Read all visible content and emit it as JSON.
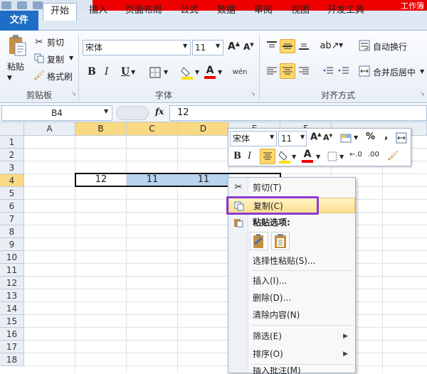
{
  "window": {
    "title_fragment": "工作簿"
  },
  "tabs": {
    "file": "文件",
    "items": [
      "开始",
      "插入",
      "页面布局",
      "公式",
      "数据",
      "审阅",
      "视图",
      "开发工具"
    ],
    "active_index": 0
  },
  "ribbon": {
    "clipboard": {
      "paste": "粘贴",
      "cut": "剪切",
      "copy": "复制",
      "format_painter": "格式刷",
      "group_label": "剪贴板"
    },
    "font": {
      "font_name": "宋体",
      "font_size": "11",
      "bold": "B",
      "italic": "I",
      "underline": "U",
      "group_label": "字体"
    },
    "alignment": {
      "wrap_text": "自动换行",
      "merge_center": "合并后居中",
      "group_label": "对齐方式"
    }
  },
  "formula_bar": {
    "name_box": "B4",
    "fx": "fx",
    "value": "12"
  },
  "grid": {
    "columns": [
      "A",
      "B",
      "C",
      "D",
      "E",
      "F"
    ],
    "rows": [
      "1",
      "2",
      "3",
      "4",
      "5",
      "6",
      "7",
      "8",
      "9",
      "10",
      "11",
      "12",
      "13",
      "14",
      "15",
      "16",
      "17",
      "18"
    ],
    "row4_values": [
      "12",
      "11",
      "11"
    ]
  },
  "mini_toolbar": {
    "font_name": "宋体",
    "font_size": "11",
    "bold": "B",
    "italic": "I",
    "percent": "%",
    "comma": ","
  },
  "context_menu": {
    "items": [
      {
        "label": "剪切(T)",
        "has_submenu": false
      },
      {
        "label": "复制(C)",
        "has_submenu": false,
        "highlighted": true
      },
      {
        "label": "粘贴选项:",
        "has_submenu": false,
        "bold": true
      },
      {
        "label": "选择性粘贴(S)...",
        "has_submenu": false
      },
      {
        "label": "插入(I)...",
        "has_submenu": false
      },
      {
        "label": "删除(D)...",
        "has_submenu": false
      },
      {
        "label": "清除内容(N)",
        "has_submenu": false
      },
      {
        "label": "筛选(E)",
        "has_submenu": true
      },
      {
        "label": "排序(O)",
        "has_submenu": true
      },
      {
        "label": "插入批注(M)",
        "has_submenu": false
      }
    ]
  },
  "colors": {
    "file_tab": "#1f6ec6",
    "selected_header": "#f9d983",
    "selected_cells": "#b8d3ee",
    "highlight_box": "#8c3ad6"
  }
}
